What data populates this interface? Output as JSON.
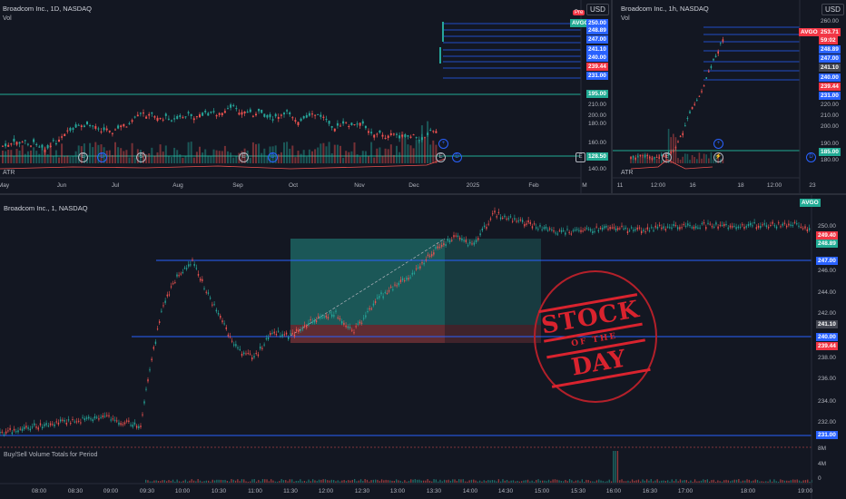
{
  "currency": "USD",
  "panel_daily": {
    "title": "Broadcom Inc., 1D, NASDAQ",
    "vol_label": "Vol",
    "atr_label": "ATR",
    "pre_badge": "Pre",
    "symbol_tag": "AVGO",
    "price_tags": [
      {
        "text": "250.00",
        "bg": "#2962ff"
      },
      {
        "text": "248.89",
        "bg": "#2962ff"
      },
      {
        "text": "247.00",
        "bg": "#2962ff"
      },
      {
        "text": "241.10",
        "bg": "#2962ff"
      },
      {
        "text": "240.00",
        "bg": "#2962ff"
      },
      {
        "text": "239.44",
        "bg": "#f23645"
      },
      {
        "text": "231.00",
        "bg": "#2962ff"
      },
      {
        "text": "195.00",
        "bg": "#22ab94"
      },
      {
        "text": "128.50",
        "bg": "#22ab94"
      }
    ],
    "y_ticks": [
      "210.00",
      "200.00",
      "180.00",
      "160.00",
      "140.00"
    ],
    "x_ticks": [
      "May",
      "Jun",
      "Jul",
      "Aug",
      "Sep",
      "Oct",
      "Nov",
      "Dec",
      "2025",
      "Feb",
      "M"
    ]
  },
  "panel_hourly": {
    "title": "Broadcom Inc., 1h, NASDAQ",
    "vol_label": "Vol",
    "atr_label": "ATR",
    "currency": "USD",
    "price_tags": [
      {
        "text": "253.71",
        "bg": "#f23645"
      },
      {
        "text": "59:02",
        "bg": "#f23645"
      },
      {
        "text": "248.89",
        "bg": "#2962ff"
      },
      {
        "text": "247.00",
        "bg": "#2962ff"
      },
      {
        "text": "241.10",
        "bg": "#434651"
      },
      {
        "text": "240.00",
        "bg": "#2962ff"
      },
      {
        "text": "239.44",
        "bg": "#f23645"
      },
      {
        "text": "231.00",
        "bg": "#2962ff"
      },
      {
        "text": "185.00",
        "bg": "#22ab94"
      }
    ],
    "symbol_tag": "AVGO",
    "y_ticks": [
      "260.00",
      "220.00",
      "210.00",
      "200.00",
      "190.00",
      "180.00"
    ],
    "x_ticks": [
      "11",
      "12:00",
      "16",
      "18",
      "12:00",
      "23"
    ]
  },
  "panel_main": {
    "title": "Broadcom Inc., 1, NASDAQ",
    "symbol_tag": "AVGO",
    "volume_label": "Buy/Sell Volume Totals for Period",
    "y_ticks": [
      "250.00",
      "246.00",
      "244.00",
      "242.00",
      "238.00",
      "236.00",
      "234.00",
      "232.00"
    ],
    "price_tags": [
      {
        "text": "249.40",
        "bg": "#f23645"
      },
      {
        "text": "248.89",
        "bg": "#22ab94"
      },
      {
        "text": "247.00",
        "bg": "#2962ff"
      },
      {
        "text": "241.10",
        "bg": "#434651"
      },
      {
        "text": "240.00",
        "bg": "#2962ff"
      },
      {
        "text": "239.44",
        "bg": "#f23645"
      },
      {
        "text": "231.00",
        "bg": "#2962ff"
      }
    ],
    "vol_ticks": [
      "8M",
      "4M",
      "0"
    ],
    "x_ticks": [
      "08:00",
      "08:30",
      "09:00",
      "09:30",
      "10:00",
      "10:30",
      "11:00",
      "11:30",
      "12:00",
      "12:30",
      "13:00",
      "13:30",
      "14:00",
      "14:30",
      "15:00",
      "15:30",
      "16:00",
      "16:30",
      "17:00",
      "18:00",
      "19:00"
    ]
  },
  "stamp": {
    "line1": "STOCK",
    "line2": "OF THE",
    "line3": "DAY"
  },
  "colors": {
    "bg": "#131722",
    "up": "#26a69a",
    "down": "#ef5350",
    "line_blue": "#2962ff",
    "line_teal": "#22ab94"
  }
}
